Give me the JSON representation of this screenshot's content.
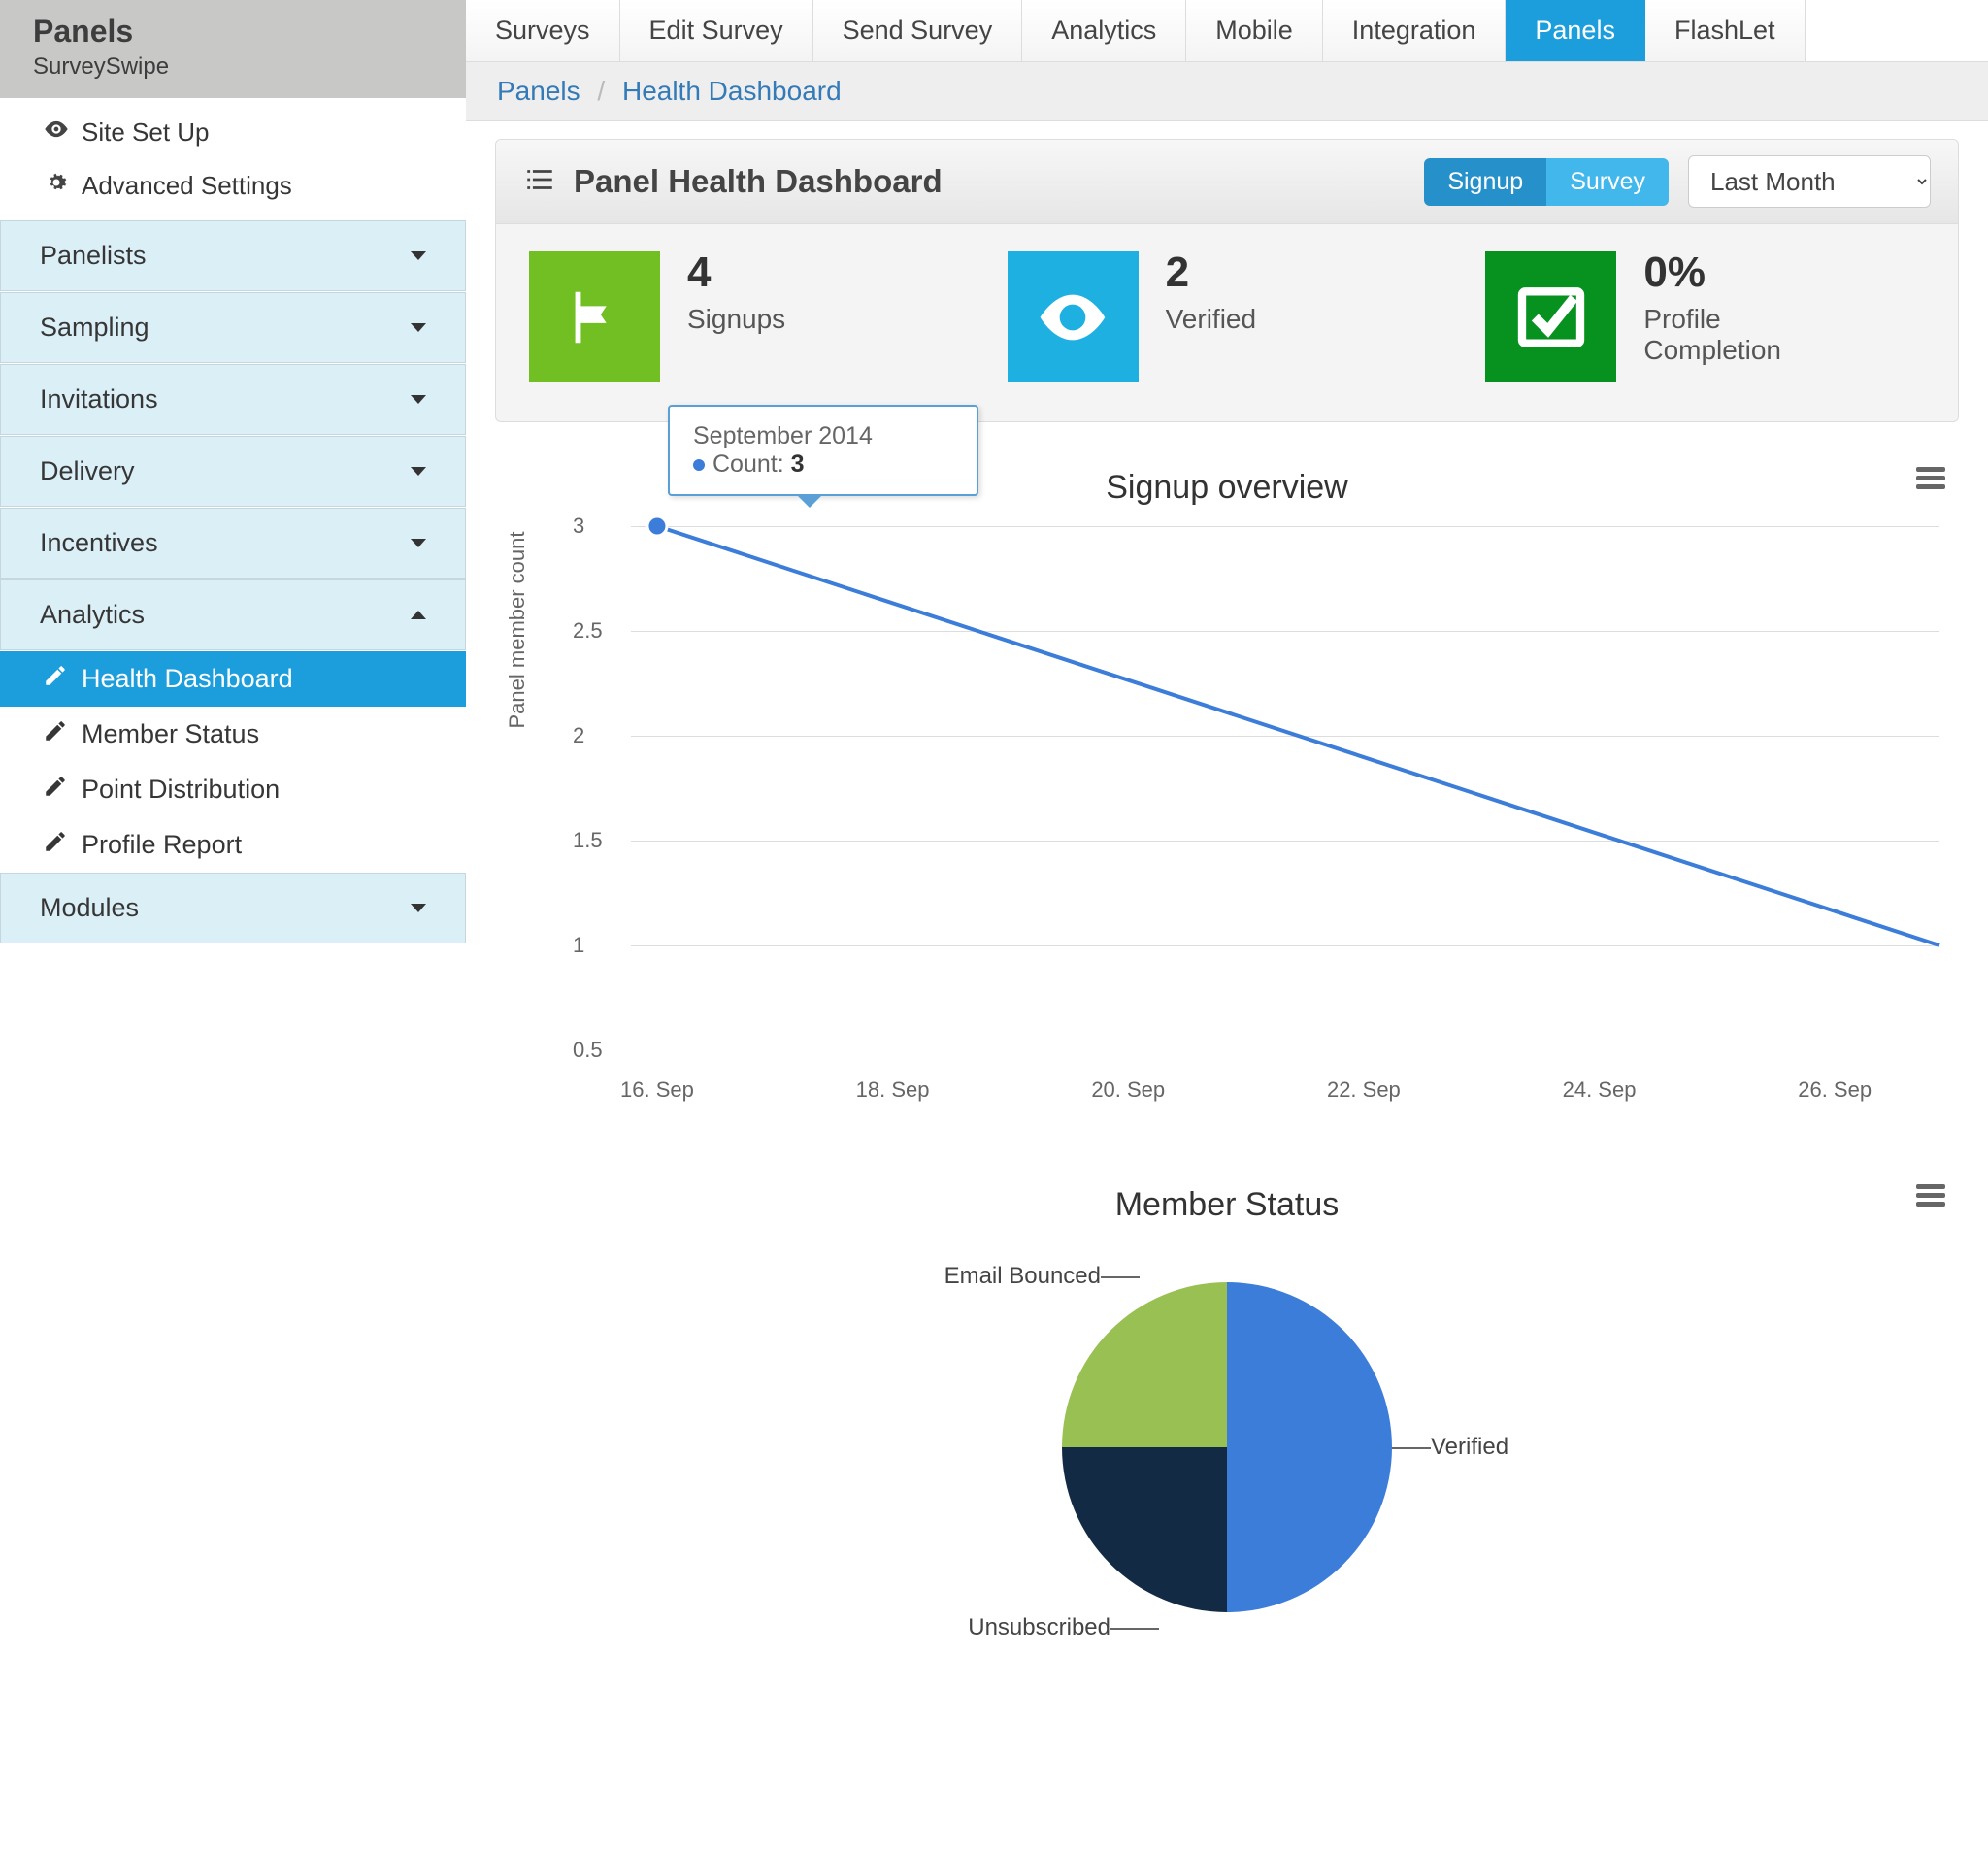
{
  "sidebar": {
    "title": "Panels",
    "subtitle": "SurveySwipe",
    "toplinks": [
      {
        "label": "Site Set Up"
      },
      {
        "label": "Advanced Settings"
      }
    ],
    "sections": [
      {
        "label": "Panelists"
      },
      {
        "label": "Sampling"
      },
      {
        "label": "Invitations"
      },
      {
        "label": "Delivery"
      },
      {
        "label": "Incentives"
      },
      {
        "label": "Analytics"
      },
      {
        "label": "Modules"
      }
    ],
    "analytics_items": [
      {
        "label": "Health Dashboard"
      },
      {
        "label": "Member Status"
      },
      {
        "label": "Point Distribution"
      },
      {
        "label": "Profile Report"
      }
    ]
  },
  "topnav": [
    "Surveys",
    "Edit Survey",
    "Send Survey",
    "Analytics",
    "Mobile",
    "Integration",
    "Panels",
    "FlashLet"
  ],
  "topnav_active": "Panels",
  "breadcrumb": {
    "a": "Panels",
    "b": "Health Dashboard"
  },
  "panel": {
    "title": "Panel Health Dashboard",
    "toggle": {
      "signup": "Signup",
      "survey": "Survey"
    },
    "date_selected": "Last Month"
  },
  "stats": {
    "signups": {
      "value": "4",
      "label": "Signups"
    },
    "verified": {
      "value": "2",
      "label": "Verified"
    },
    "profile": {
      "value": "0%",
      "label": "Profile Completion"
    }
  },
  "chart1": {
    "title": "Signup overview",
    "ylabel": "Panel member count",
    "tooltip_title": "September 2014",
    "tooltip_series": "Count",
    "tooltip_value": "3"
  },
  "chart2": {
    "title": "Member Status",
    "labels": {
      "verified": "Verified",
      "unsub": "Unsubscribed",
      "bounced": "Email Bounced"
    }
  },
  "chart_data": [
    {
      "type": "line",
      "title": "Signup overview",
      "x": [
        "16. Sep",
        "18. Sep",
        "20. Sep",
        "22. Sep",
        "24. Sep",
        "26. Sep"
      ],
      "ylabel": "Panel member count",
      "ylim": [
        0.5,
        3
      ],
      "series": [
        {
          "name": "Count",
          "points": [
            {
              "x": "16. Sep",
              "y": 3
            },
            {
              "x": "27. Sep",
              "y": 1
            }
          ]
        }
      ],
      "highlight": {
        "x": "16. Sep",
        "y": 3,
        "label": "September 2014"
      }
    },
    {
      "type": "pie",
      "title": "Member Status",
      "slices": [
        {
          "name": "Verified",
          "value": 50,
          "color": "#3b7dd8"
        },
        {
          "name": "Unsubscribed",
          "value": 25,
          "color": "#122a43"
        },
        {
          "name": "Email Bounced",
          "value": 25,
          "color": "#99c052"
        }
      ]
    }
  ]
}
